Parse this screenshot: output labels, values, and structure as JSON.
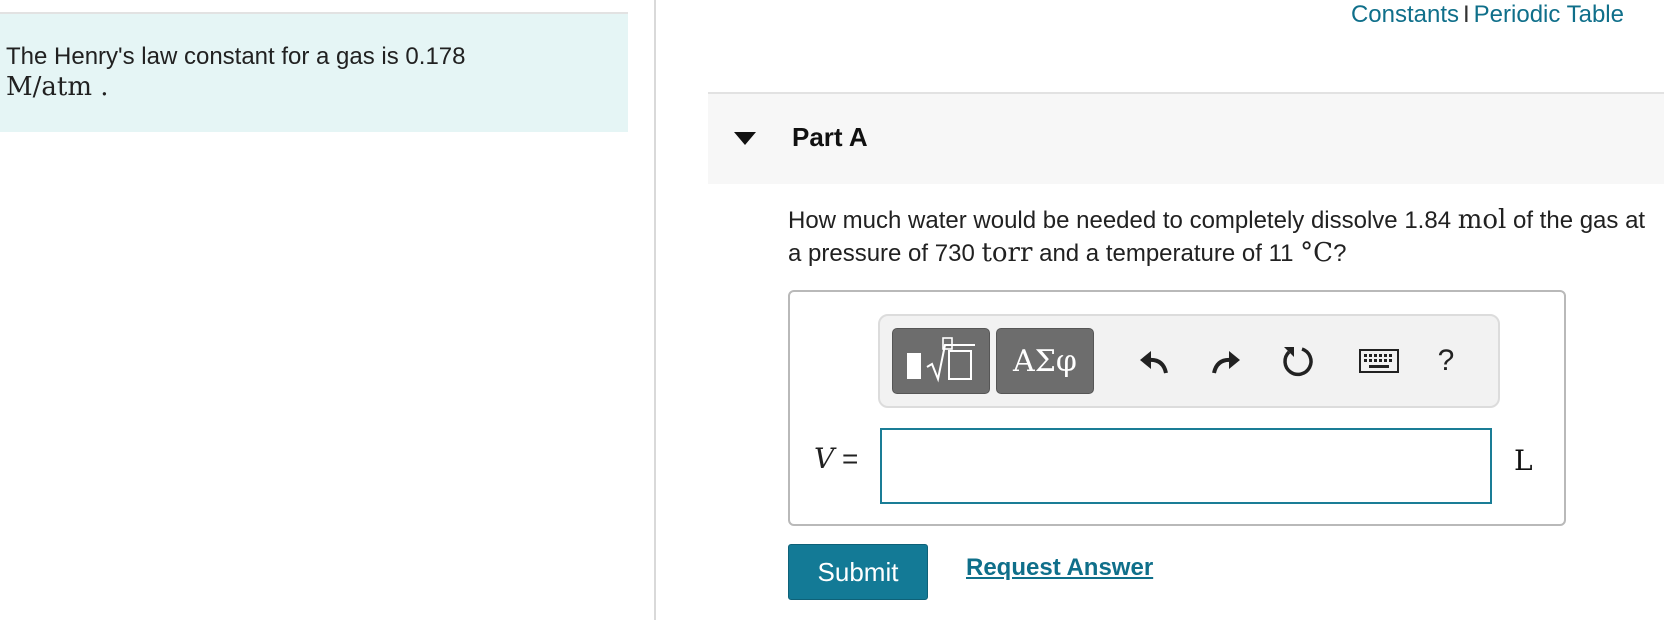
{
  "intro": {
    "text": "The Henry's law constant for a gas is 0.178",
    "unit": "M/atm ."
  },
  "links": {
    "constants": "Constants",
    "separator": "I",
    "periodic_table": "Periodic Table"
  },
  "part": {
    "title": "Part A"
  },
  "question": {
    "t1": "How much water would be needed to completely dissolve 1.84 ",
    "u1": "mol",
    "t2": " of the gas at a pressure of 730 ",
    "u2": "torr",
    "t3": " and a temperature of 11 ",
    "u3": "°C",
    "t4": "?"
  },
  "toolbar": {
    "templates_icon": "templates-sqrt-icon",
    "greek_label": "ΑΣφ",
    "undo_icon": "undo-icon",
    "redo_icon": "redo-icon",
    "reset_icon": "reset-icon",
    "keyboard_icon": "keyboard-icon",
    "help_label": "?"
  },
  "answer": {
    "variable": "V",
    "equals": "=",
    "value": "",
    "unit": "L"
  },
  "actions": {
    "submit_label": "Submit",
    "request_label": "Request Answer"
  },
  "colors": {
    "accent": "#137a96",
    "link": "#0f6f8a",
    "intro_bg": "#e5f5f5"
  }
}
